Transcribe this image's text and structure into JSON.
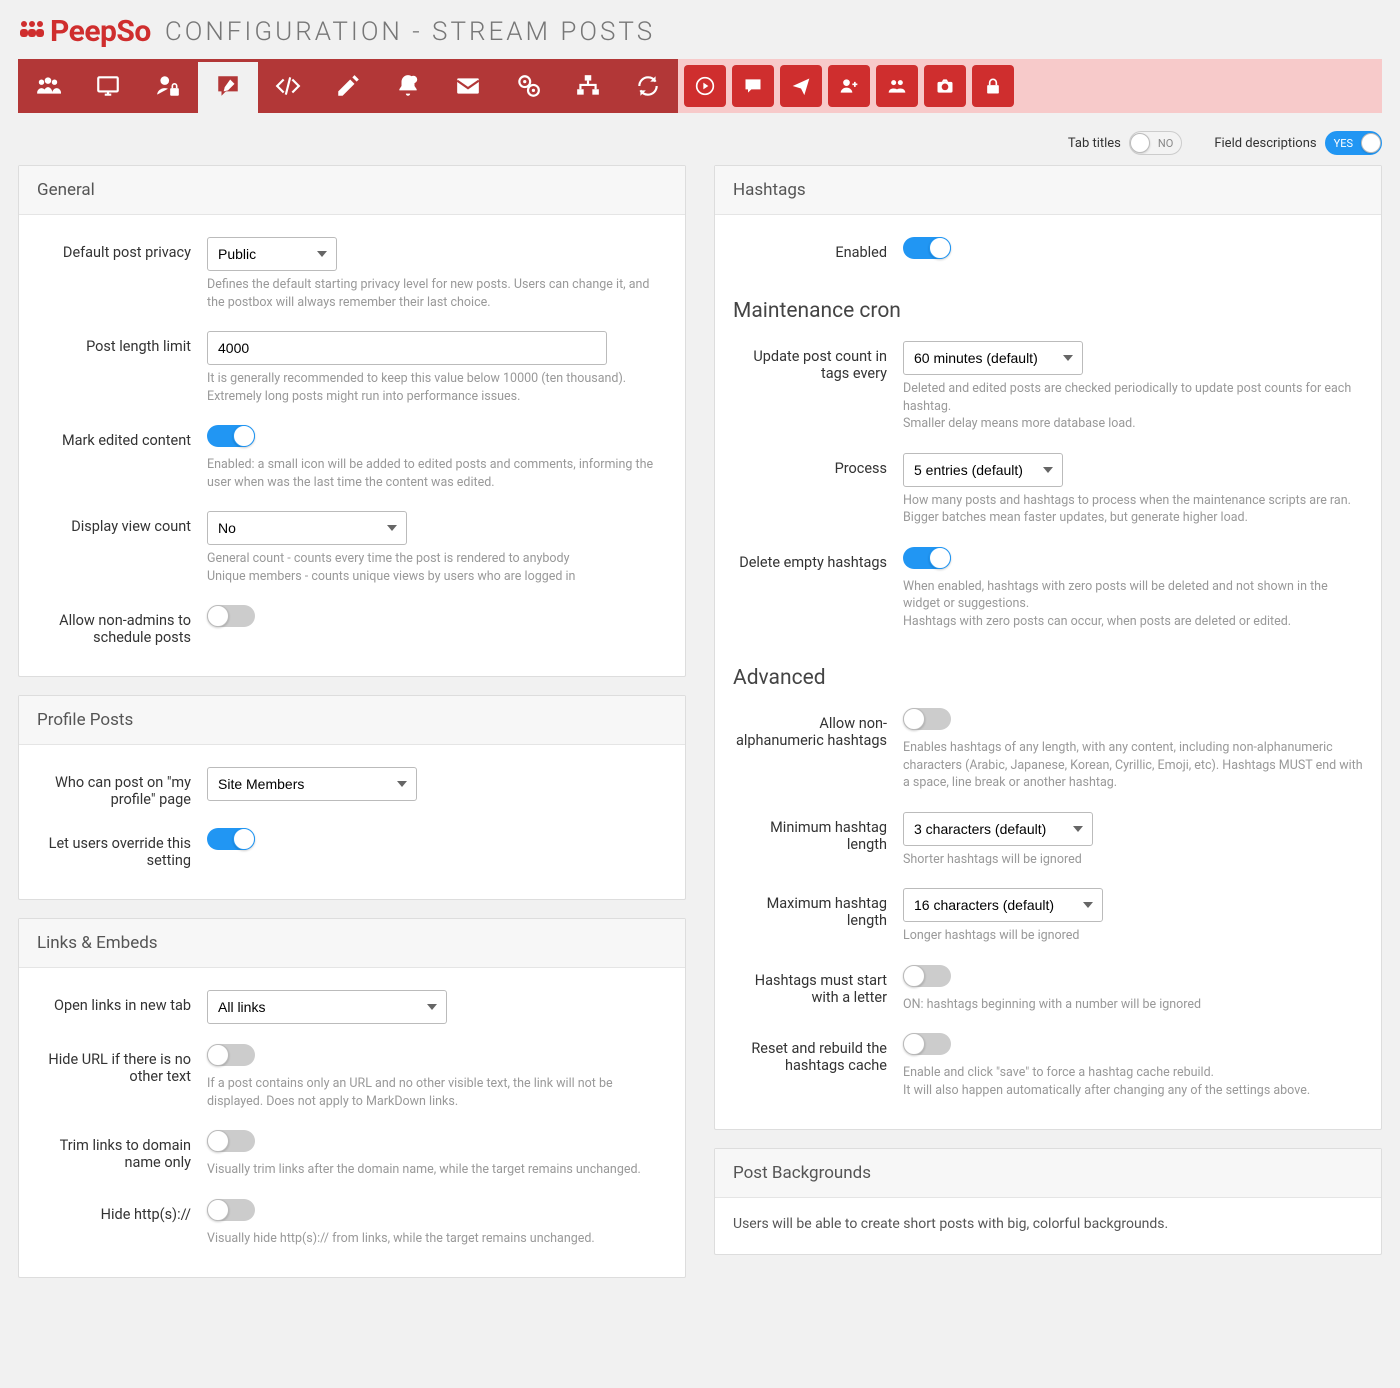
{
  "header": {
    "logo_text": "PeepSo",
    "title": "Configuration - Stream Posts"
  },
  "top_toggles": {
    "tab_titles_label": "Tab titles",
    "tab_titles_no": "NO",
    "field_desc_label": "Field descriptions",
    "field_desc_yes": "YES"
  },
  "panels": {
    "general": {
      "title": "General",
      "default_privacy": {
        "label": "Default post privacy",
        "value": "Public",
        "hint": "Defines the default starting privacy level for new posts. Users can change it, and the postbox will always remember their last choice."
      },
      "post_length": {
        "label": "Post length limit",
        "value": "4000",
        "hint": "It is generally recommended to keep this value below 10000 (ten thousand). Extremely long posts might run into performance issues."
      },
      "mark_edited": {
        "label": "Mark edited content",
        "hint": "Enabled: a small icon will be added to edited posts and comments, informing the user when was the last time the content was edited."
      },
      "view_count": {
        "label": "Display view count",
        "value": "No",
        "hint": "General count - counts every time the post is rendered to anybody\nUnique members - counts unique views by users who are logged in"
      },
      "allow_schedule": {
        "label": "Allow non-admins to schedule posts"
      }
    },
    "profile_posts": {
      "title": "Profile Posts",
      "who_can_post": {
        "label": "Who can post on \"my profile\" page",
        "value": "Site Members"
      },
      "override": {
        "label": "Let users override this setting"
      }
    },
    "links": {
      "title": "Links & Embeds",
      "open_new_tab": {
        "label": "Open links in new tab",
        "value": "All links"
      },
      "hide_url": {
        "label": "Hide URL if there is no other text",
        "hint": "If a post contains only an URL and no other visible text, the link will not be displayed. Does not apply to MarkDown links."
      },
      "trim": {
        "label": "Trim links to domain name only",
        "hint": "Visually trim links after the domain name, while the target remains unchanged."
      },
      "hide_proto": {
        "label": "Hide http(s)://",
        "hint": "Visually hide http(s):// from links, while the target remains unchanged."
      }
    },
    "hashtags": {
      "title": "Hashtags",
      "enabled": {
        "label": "Enabled"
      },
      "maintenance_title": "Maintenance cron",
      "update_every": {
        "label": "Update post count in tags every",
        "value": "60 minutes (default)",
        "hint": "Deleted and edited posts are checked periodically to update post counts for each hashtag.\nSmaller delay means more database load."
      },
      "process": {
        "label": "Process",
        "value": "5 entries (default)",
        "hint": "How many posts and hashtags to process when the maintenance scripts are ran. Bigger batches mean faster updates, but generate higher load."
      },
      "delete_empty": {
        "label": "Delete empty hashtags",
        "hint": "When enabled, hashtags with zero posts will be deleted and not shown in the widget or suggestions.\nHashtags with zero posts can occur, when posts are deleted or edited."
      },
      "advanced_title": "Advanced",
      "non_alpha": {
        "label": "Allow non-alphanumeric hashtags",
        "hint": "Enables hashtags of any length, with any content, including non-alphanumeric characters (Arabic, Japanese, Korean, Cyrillic, Emoji, etc). Hashtags MUST end with a space, line break or another hashtag."
      },
      "min_len": {
        "label": "Minimum hashtag length",
        "value": "3 characters (default)",
        "hint": "Shorter hashtags will be ignored"
      },
      "max_len": {
        "label": "Maximum hashtag length",
        "value": "16 characters (default)",
        "hint": "Longer hashtags will be ignored"
      },
      "start_letter": {
        "label": "Hashtags must start with a letter",
        "hint": "ON: hashtags beginning with a number will be ignored"
      },
      "reset": {
        "label": "Reset and rebuild the hashtags cache",
        "hint": "Enable and click \"save\" to force a hashtag cache rebuild.\nIt will also happen automatically after changing any of the settings above."
      }
    },
    "backgrounds": {
      "title": "Post Backgrounds",
      "intro": "Users will be able to create short posts with big, colorful backgrounds."
    }
  }
}
